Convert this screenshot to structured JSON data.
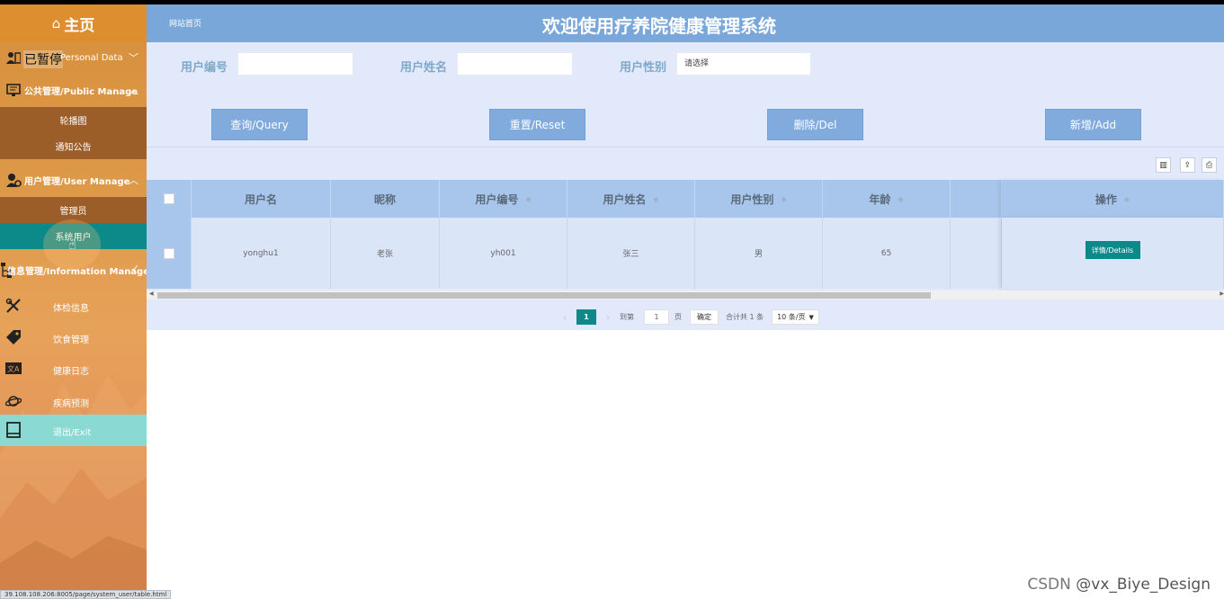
{
  "sidebar": {
    "home": "主页",
    "paused": "已暂停",
    "groups": {
      "personal": "Personal Data",
      "public": "公共管理/Public Manage",
      "user": "用户管理/User Manage",
      "info": "信息管理/Information Manage"
    },
    "public_items": [
      "轮播图",
      "通知公告"
    ],
    "user_items": [
      "管理员",
      "系统用户"
    ],
    "info_items": [
      "体检信息",
      "饮食管理",
      "健康日志",
      "疾病预测"
    ],
    "exit": "退出/Exit"
  },
  "topbar": {
    "crumb": "网站首页",
    "title": "欢迎使用疗养院健康管理系统"
  },
  "filter": {
    "user_no_label": "用户编号",
    "user_no_value": "",
    "user_name_label": "用户姓名",
    "user_name_value": "",
    "gender_label": "用户性别",
    "gender_value": "请选择"
  },
  "buttons": {
    "query": "查询/Query",
    "reset": "重置/Reset",
    "delete": "删除/Del",
    "add": "新增/Add"
  },
  "table": {
    "headers": [
      "用户名",
      "昵称",
      "用户编号",
      "用户姓名",
      "用户性别",
      "年龄",
      "",
      "操作"
    ],
    "rows": [
      {
        "username": "yonghu1",
        "nickname": "老张",
        "user_no": "yh001",
        "name": "张三",
        "gender": "男",
        "age": "65",
        "action": "详情/Details"
      }
    ]
  },
  "pager": {
    "prev": "‹",
    "current": "1",
    "next": "›",
    "goto_label": "到第",
    "goto_value": "1",
    "page_suffix": "页",
    "confirm": "确定",
    "total": "合计共 1 条",
    "page_size": "10 条/页"
  },
  "watermark": {
    "csdn": "CSDN",
    "author": "@vx_Biye_Design"
  },
  "status_url": "39.108.108.206:8005/page/system_user/table.html",
  "colors": {
    "sidebar": "#de9a4a",
    "accent": "#0c8a8a",
    "topbar": "#7aa7d9",
    "button": "#80abdc"
  }
}
